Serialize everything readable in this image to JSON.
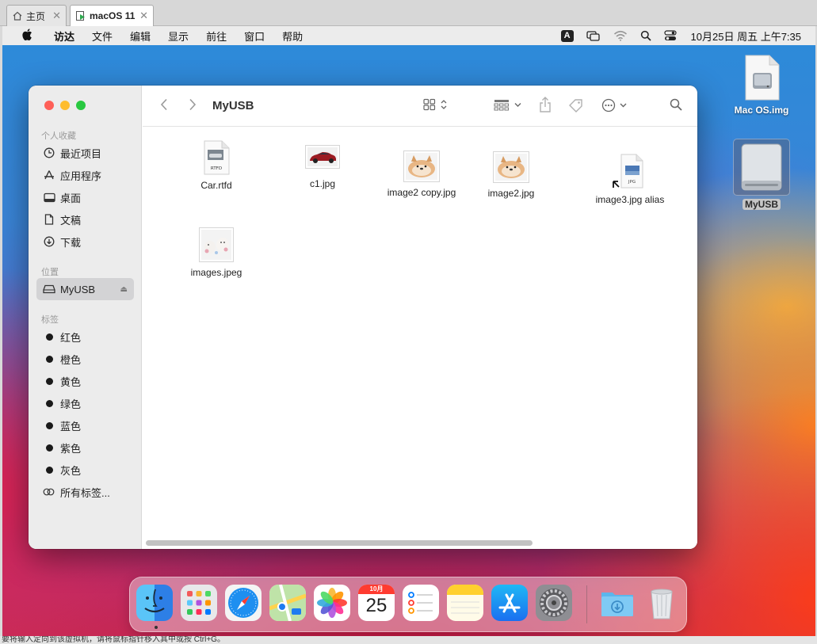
{
  "host": {
    "tabs": [
      {
        "label": "主页"
      },
      {
        "label": "macOS 11"
      }
    ],
    "status_text": "要将输入定向到该虚拟机，请将鼠标指针移入其中或按 Ctrl+G。"
  },
  "menubar": {
    "app": "访达",
    "items": [
      "文件",
      "编辑",
      "显示",
      "前往",
      "窗口",
      "帮助"
    ],
    "input_badge": "A",
    "clock": "10月25日 周五 上午7:35"
  },
  "desktop": {
    "icons": [
      {
        "label": "Mac OS.img"
      },
      {
        "label": "MyUSB"
      }
    ]
  },
  "finder": {
    "title": "MyUSB",
    "sidebar": {
      "favorites_header": "个人收藏",
      "favorites": [
        {
          "label": "最近项目",
          "icon": "clock-icon"
        },
        {
          "label": "应用程序",
          "icon": "applications-icon"
        },
        {
          "label": "桌面",
          "icon": "desktop-icon"
        },
        {
          "label": "文稿",
          "icon": "document-icon"
        },
        {
          "label": "下载",
          "icon": "download-icon"
        }
      ],
      "locations_header": "位置",
      "locations": [
        {
          "label": "MyUSB",
          "icon": "drive-icon"
        }
      ],
      "tags_header": "标签",
      "tags": [
        {
          "label": "红色"
        },
        {
          "label": "橙色"
        },
        {
          "label": "黄色"
        },
        {
          "label": "绿色"
        },
        {
          "label": "蓝色"
        },
        {
          "label": "紫色"
        },
        {
          "label": "灰色"
        },
        {
          "label": "所有标签..."
        }
      ]
    },
    "files": [
      {
        "name": "Car.rtfd",
        "badge": "RTFD"
      },
      {
        "name": "c1.jpg"
      },
      {
        "name": "image2 copy.jpg"
      },
      {
        "name": "image2.jpg"
      },
      {
        "name": "image3.jpg alias",
        "badge": "JPG"
      },
      {
        "name": "images.jpeg"
      }
    ]
  },
  "dock": {
    "calendar_month": "10月",
    "calendar_day": "25",
    "apps": [
      "finder-icon",
      "launchpad-icon",
      "safari-icon",
      "maps-icon",
      "photos-icon",
      "calendar-icon",
      "reminders-icon",
      "notes-icon",
      "app-store-icon",
      "system-preferences-icon",
      "downloads-folder-icon",
      "trash-icon"
    ]
  },
  "colors": {
    "close": "#fe5f57",
    "minimize": "#febc2e",
    "zoom": "#28c840",
    "sidebar_bg": "#ececec",
    "selection": "#d3d3d5"
  }
}
